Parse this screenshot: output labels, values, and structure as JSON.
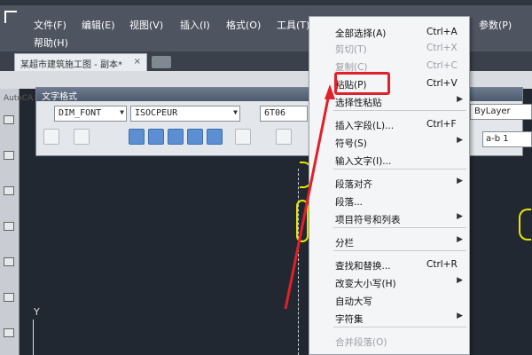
{
  "menubar": {
    "row1": [
      "文件(F)",
      "编辑(E)",
      "视图(V)",
      "插入(I)",
      "格式(O)",
      "工具(T)",
      "参数(P)"
    ],
    "row2": [
      "帮助(H)"
    ]
  },
  "tabs": {
    "doc_tab": "某超市建筑施工图 - 副本*",
    "close": "×"
  },
  "app_label": "AutoCA",
  "text_format": {
    "title": "文字格式",
    "font_style": "DIM_FONT",
    "font_name": "ISOCPEUR",
    "text_height": "6T06",
    "color": "ByLayer",
    "ab_field": "a-b 1"
  },
  "context_menu": {
    "items": [
      {
        "label": "全部选择(A)",
        "shortcut": "Ctrl+A",
        "disabled": false
      },
      {
        "label": "剪切(T)",
        "shortcut": "Ctrl+X",
        "disabled": true
      },
      {
        "label": "复制(C)",
        "shortcut": "Ctrl+C",
        "disabled": true
      },
      {
        "label": "粘贴(P)",
        "shortcut": "Ctrl+V",
        "disabled": false
      },
      {
        "label": "选择性粘贴",
        "shortcut": "",
        "disabled": false,
        "submenu": true
      },
      {
        "label": "插入字段(L)...",
        "shortcut": "Ctrl+F",
        "disabled": false
      },
      {
        "label": "符号(S)",
        "shortcut": "",
        "disabled": false,
        "submenu": true
      },
      {
        "label": "输入文字(I)...",
        "shortcut": "",
        "disabled": false
      },
      {
        "label": "段落对齐",
        "shortcut": "",
        "disabled": false,
        "submenu": true
      },
      {
        "label": "段落...",
        "shortcut": "",
        "disabled": false
      },
      {
        "label": "项目符号和列表",
        "shortcut": "",
        "disabled": false,
        "submenu": true
      },
      {
        "label": "分栏",
        "shortcut": "",
        "disabled": false,
        "submenu": true
      },
      {
        "label": "查找和替换...",
        "shortcut": "Ctrl+R",
        "disabled": false
      },
      {
        "label": "改变大小写(H)",
        "shortcut": "",
        "disabled": false,
        "submenu": true
      },
      {
        "label": "自动大写",
        "shortcut": "",
        "disabled": false
      },
      {
        "label": "字符集",
        "shortcut": "",
        "disabled": false,
        "submenu": true
      },
      {
        "label": "合并段落(O)",
        "shortcut": "",
        "disabled": true
      }
    ]
  },
  "canvas": {
    "ucs_y": "Y"
  },
  "colors": {
    "highlight": "#e0202a",
    "menubar": "#4e5561",
    "canvas": "#212831"
  }
}
